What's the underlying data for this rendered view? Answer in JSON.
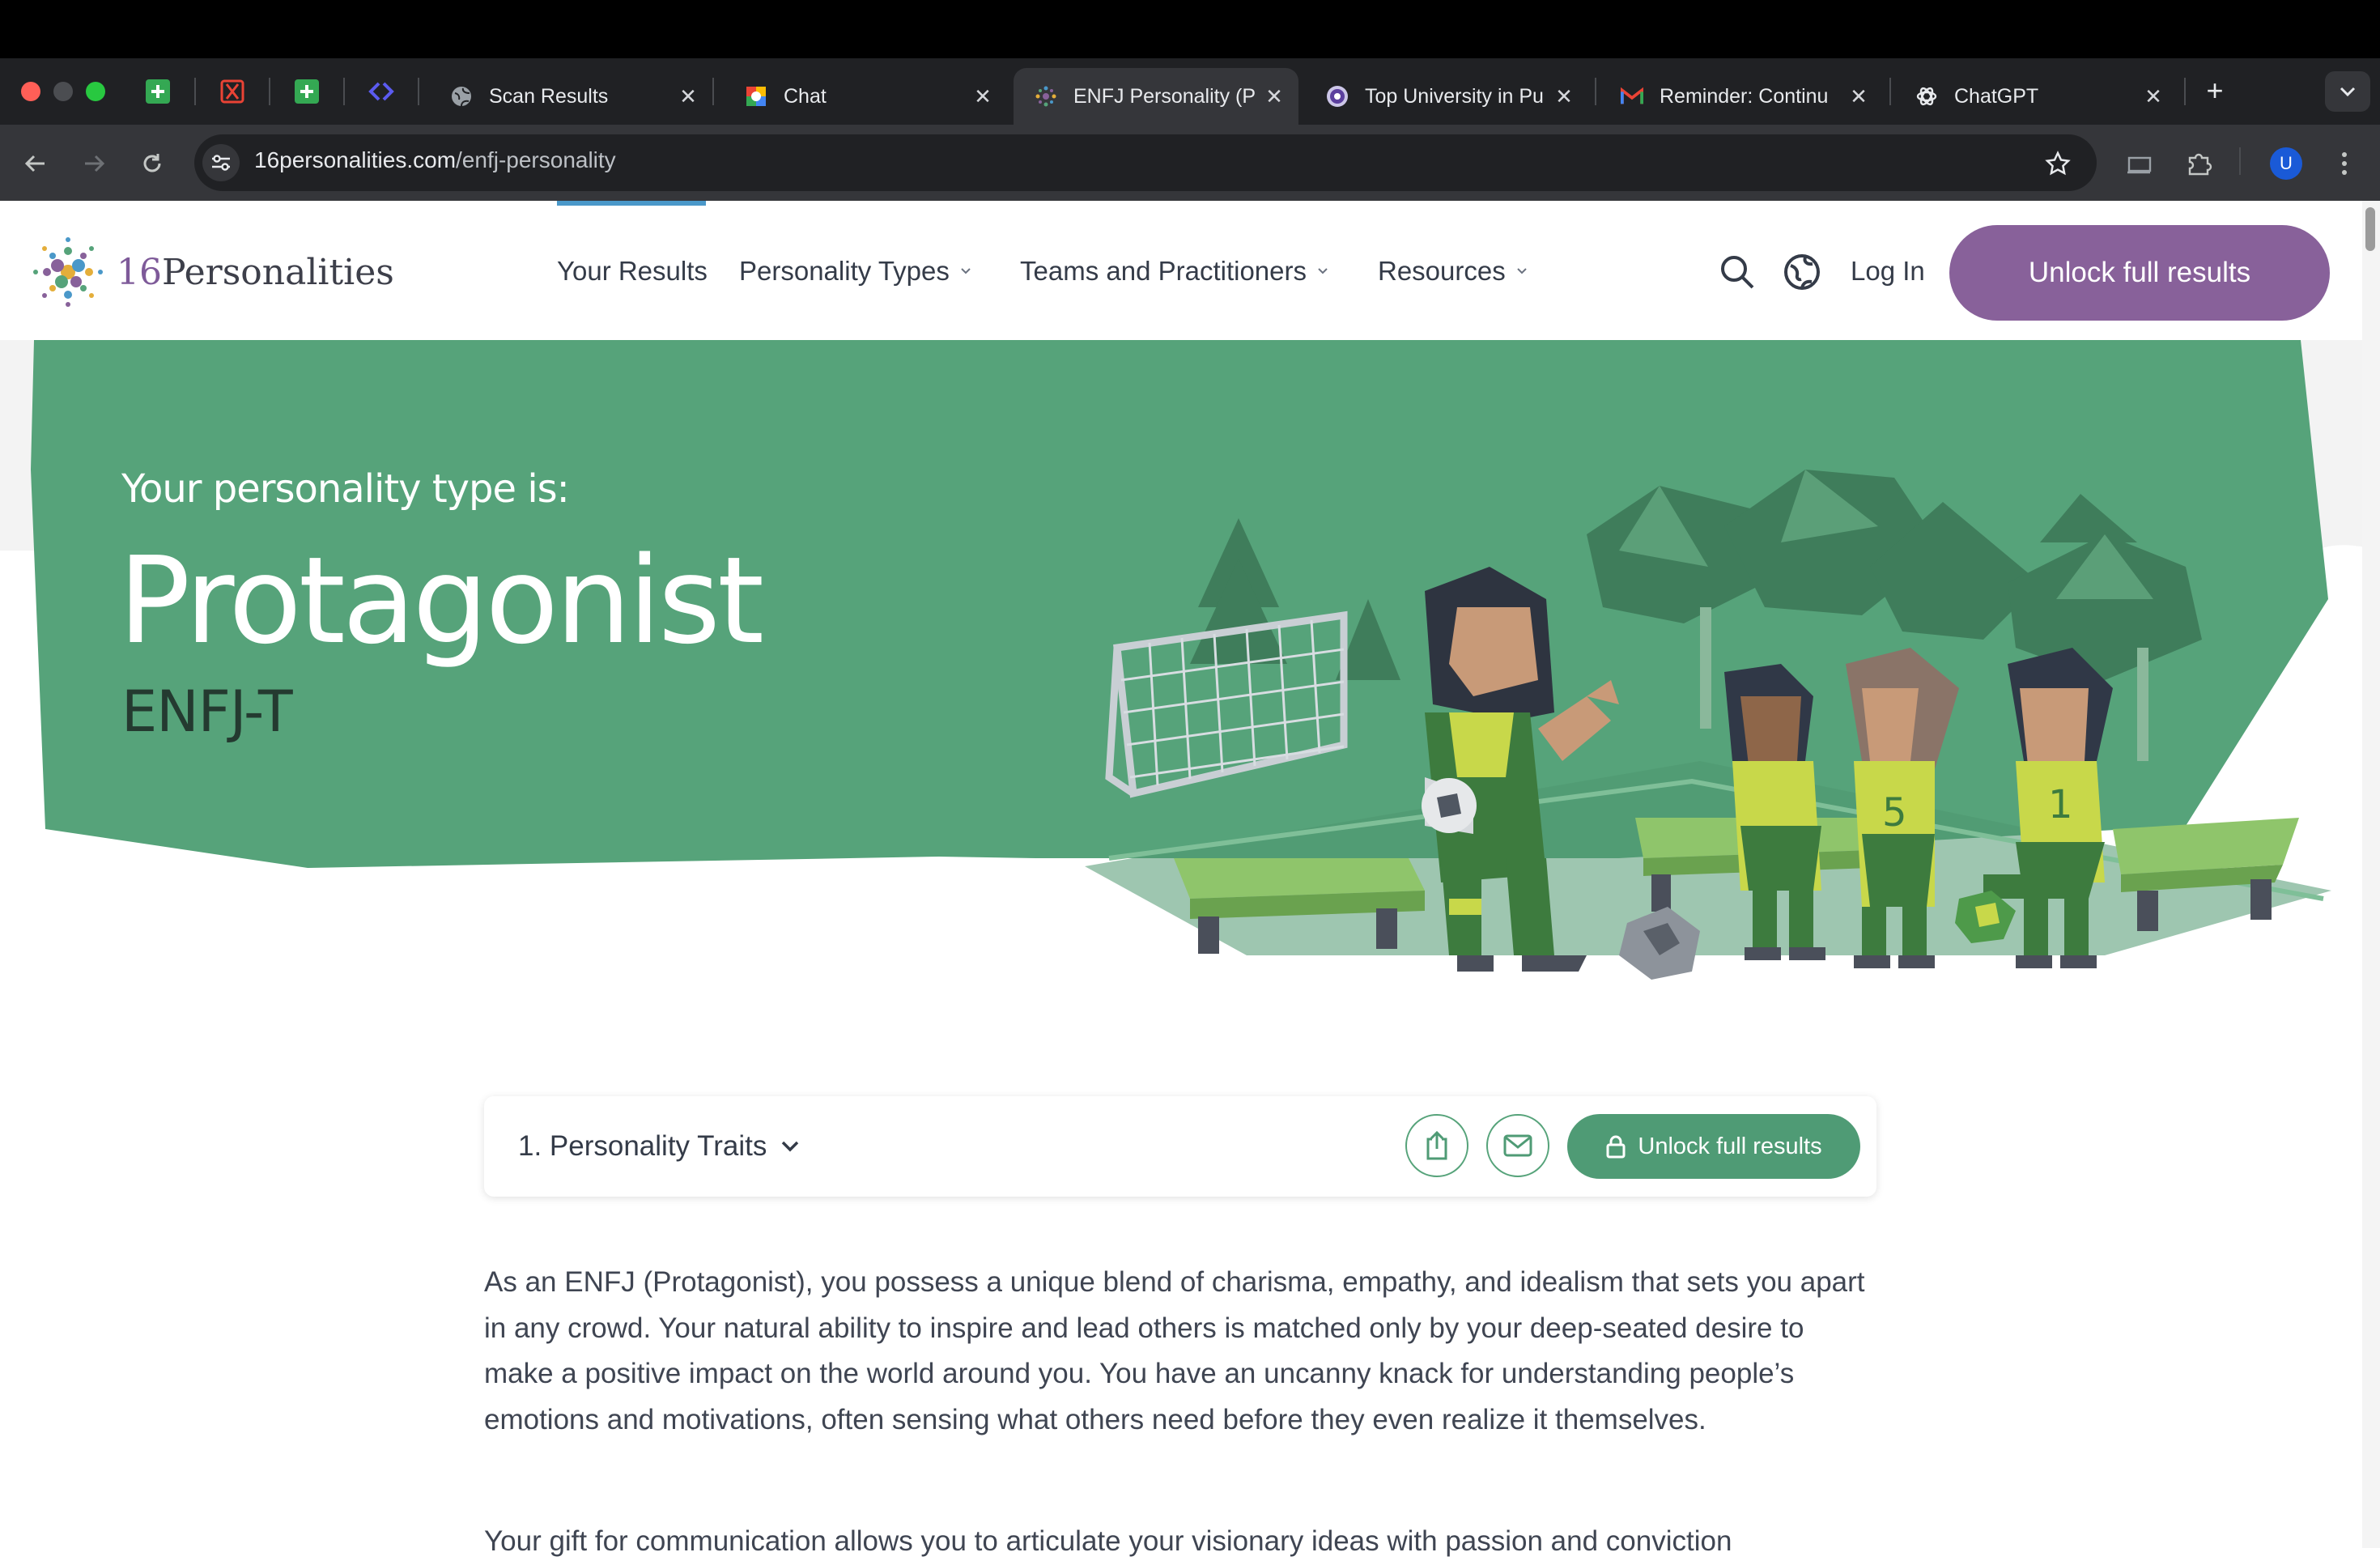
{
  "browser": {
    "tabs": [
      {
        "title": "Scan Results",
        "icon": "globe-icon"
      },
      {
        "title": "Chat",
        "icon": "chat-icon"
      },
      {
        "title": "ENFJ Personality (P",
        "icon": "16p-icon"
      },
      {
        "title": "Top University in Pu",
        "icon": "university-icon"
      },
      {
        "title": "Reminder: Continu",
        "icon": "gmail-icon"
      },
      {
        "title": "ChatGPT",
        "icon": "chatgpt-icon"
      }
    ],
    "url_domain": "16personalities.com",
    "url_path": "/enfj-personality",
    "profile_initial": "U"
  },
  "site": {
    "logo_number": "16",
    "logo_word": "Personalities",
    "nav": {
      "your_results": "Your Results",
      "personality_types": "Personality Types",
      "teams": "Teams and Practitioners",
      "resources": "Resources"
    },
    "login": "Log In",
    "unlock_button": "Unlock full results"
  },
  "hero": {
    "subtitle": "Your personality type is:",
    "title": "Protagonist",
    "code": "ENFJ-T",
    "colors": {
      "band": "#56a37a",
      "type_code": "#243a30"
    }
  },
  "section": {
    "title": "1. Personality Traits",
    "unlock_label": "Unlock full results"
  },
  "body": {
    "paragraph1": "As an ENFJ (Protagonist), you possess a unique blend of charisma, empathy, and idealism that sets you apart in any crowd. Your natural ability to inspire and lead others is matched only by your deep-seated desire to make a positive impact on the world around you. You have an uncanny knack for understanding people’s emotions and motivations, often sensing what others need before they even realize it themselves.",
    "paragraph2": "Your gift for communication allows you to articulate your visionary ideas with passion and conviction"
  }
}
